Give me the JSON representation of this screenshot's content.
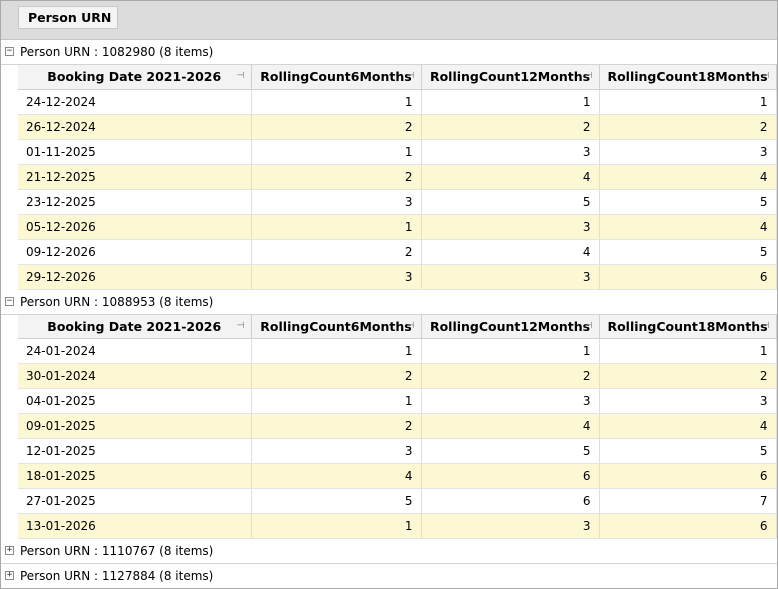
{
  "group_panel": {
    "chip_label": "Person URN"
  },
  "columns": [
    "Booking Date 2021-2026",
    "RollingCount6Months",
    "RollingCount12Months",
    "RollingCount18Months"
  ],
  "groups": [
    {
      "label": "Person URN : 1082980 (8 items)",
      "expanded": true,
      "rows": [
        [
          "24-12-2024",
          "1",
          "1",
          "1"
        ],
        [
          "26-12-2024",
          "2",
          "2",
          "2"
        ],
        [
          "01-11-2025",
          "1",
          "3",
          "3"
        ],
        [
          "21-12-2025",
          "2",
          "4",
          "4"
        ],
        [
          "23-12-2025",
          "3",
          "5",
          "5"
        ],
        [
          "05-12-2026",
          "1",
          "3",
          "4"
        ],
        [
          "09-12-2026",
          "2",
          "4",
          "5"
        ],
        [
          "29-12-2026",
          "3",
          "3",
          "6"
        ]
      ]
    },
    {
      "label": "Person URN : 1088953 (8 items)",
      "expanded": true,
      "rows": [
        [
          "24-01-2024",
          "1",
          "1",
          "1"
        ],
        [
          "30-01-2024",
          "2",
          "2",
          "2"
        ],
        [
          "04-01-2025",
          "1",
          "3",
          "3"
        ],
        [
          "09-01-2025",
          "2",
          "4",
          "4"
        ],
        [
          "12-01-2025",
          "3",
          "5",
          "5"
        ],
        [
          "18-01-2025",
          "4",
          "6",
          "6"
        ],
        [
          "27-01-2025",
          "5",
          "6",
          "7"
        ],
        [
          "13-01-2026",
          "1",
          "3",
          "6"
        ]
      ]
    },
    {
      "label": "Person URN : 1110767 (8 items)",
      "expanded": false,
      "rows": []
    },
    {
      "label": "Person URN : 1127884 (8 items)",
      "expanded": false,
      "rows": []
    }
  ],
  "icons": {
    "expanded": "minus-box-icon",
    "collapsed": "plus-box-icon",
    "column_pin": "pin-icon"
  },
  "colors": {
    "alt_row": "#fdf8d4",
    "header_bg": "#f3f3f3",
    "group_panel_bg": "#dcdcdc"
  }
}
